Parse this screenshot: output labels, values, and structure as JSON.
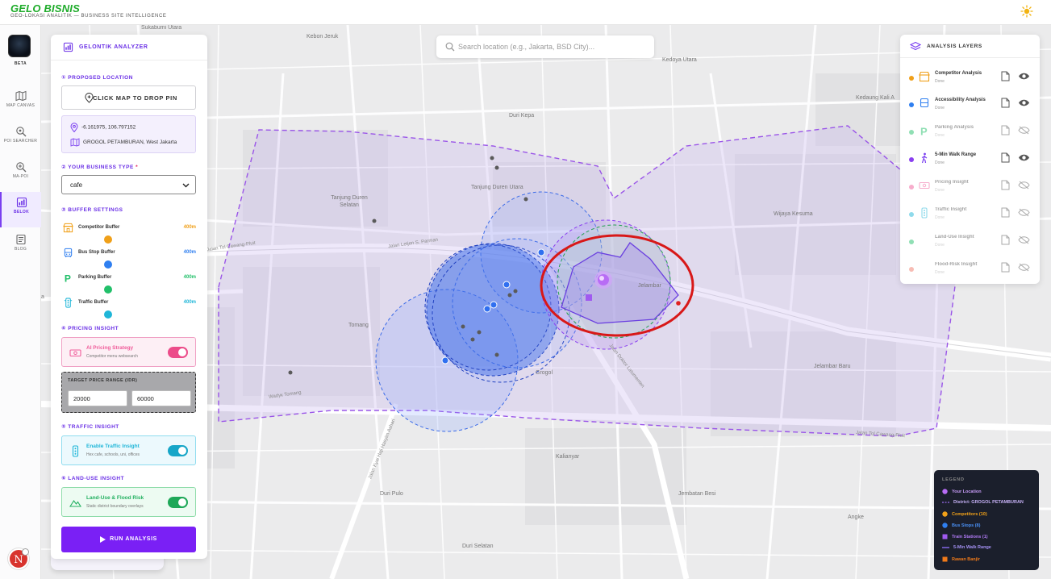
{
  "app": {
    "brand": "GELO BISNIS",
    "tagline": "GEO-LOKASI ANALITIK — BUSINESS SITE INTELLIGENCE",
    "beta_label": "BETA",
    "avatar_letter": "N"
  },
  "nav": [
    {
      "label": "MAP CANVAS",
      "icon": "map-icon"
    },
    {
      "label": "POI SEARCHER",
      "icon": "poi-search-icon"
    },
    {
      "label": "MA-POI",
      "icon": "ma-poi-icon"
    },
    {
      "label": "BELOK",
      "icon": "bar-chart-icon",
      "active": true
    },
    {
      "label": "BLOG",
      "icon": "blog-icon"
    }
  ],
  "analyzer": {
    "title": "GELONTIK ANALYZER",
    "s1": "① PROPOSED LOCATION",
    "drop_pin": "CLICK MAP TO DROP PIN",
    "coords": "-6.161975, 106.797152",
    "district": "GROGOL PETAMBURAN, West Jakarta",
    "s2": "② YOUR BUSINESS TYPE",
    "required": "*",
    "business_type": "cafe",
    "s3": "③ BUFFER SETTINGS",
    "buffers": [
      {
        "name": "Competitor Buffer",
        "value": "400m",
        "color": "#f0a019"
      },
      {
        "name": "Bus Stop Buffer",
        "value": "400m",
        "color": "#2f7ff0"
      },
      {
        "name": "Parking Buffer",
        "value": "400m",
        "color": "#22c06a"
      },
      {
        "name": "Traffic Buffer",
        "value": "400m",
        "color": "#1fb6d8"
      }
    ],
    "s4": "④ PRICING INSIGHT",
    "pricing_title": "AI Pricing Strategy",
    "pricing_sub": "Competitor menu websearch",
    "price_range_label": "TARGET PRICE RANGE (IDR)",
    "price_min": "20000",
    "price_max": "60000",
    "s5": "⑤ TRAFFIC INSIGHT",
    "traffic_title": "Enable Traffic Insight",
    "traffic_sub": "Hex cafe, schools, uni, offices",
    "s6": "⑥ LAND-USE INSIGHT",
    "landuse_title": "Land-Use & Flood Risk",
    "landuse_sub": "Static district boundary overlays",
    "run_label": "RUN ANALYSIS"
  },
  "search": {
    "placeholder": "Search location (e.g., Jakarta, BSD City)..."
  },
  "layers": {
    "title": "ANALYSIS LAYERS",
    "items": [
      {
        "name": "Competitor Analysis",
        "status": "Done",
        "dot": "#f0a019",
        "icon": "store-icon",
        "on": true
      },
      {
        "name": "Accessibility Analysis",
        "status": "Done",
        "dot": "#2f7ff0",
        "icon": "bus-icon",
        "on": true
      },
      {
        "name": "Parking Analysis",
        "status": "Done",
        "dot": "#22c06a",
        "icon": "parking-icon",
        "on": false
      },
      {
        "name": "5-Min Walk Range",
        "status": "Done",
        "dot": "#8a3ff0",
        "icon": "walk-icon",
        "on": true
      },
      {
        "name": "Pricing Insight",
        "status": "Done",
        "dot": "#f05c9a",
        "icon": "money-icon",
        "on": false
      },
      {
        "name": "Traffic Insight",
        "status": "Done",
        "dot": "#1fb6d8",
        "icon": "traffic-icon",
        "on": false
      },
      {
        "name": "Land-Use Insight",
        "status": "Done",
        "dot": "#22c06a",
        "icon": "land-icon",
        "on": false
      },
      {
        "name": "Flood-Risk Insight",
        "status": "Done",
        "dot": "#f07a6a",
        "icon": "flood-icon",
        "on": false
      }
    ]
  },
  "legend": {
    "title": "LEGEND",
    "items": [
      {
        "label": "Your Location",
        "color": "#b86cf5",
        "kind": "dot"
      },
      {
        "label": "District: GROGOL PETAMBURAN",
        "color": "#9a6cf0",
        "kind": "dash"
      },
      {
        "label": "Competitors (10)",
        "color": "#f0a019",
        "kind": "dot"
      },
      {
        "label": "Bus Stops (8)",
        "color": "#2f7ff0",
        "kind": "dot"
      },
      {
        "label": "Train Stations (1)",
        "color": "#a05af0",
        "kind": "square"
      },
      {
        "label": "5-Min Walk Range",
        "color": "#8a6cf0",
        "kind": "line"
      },
      {
        "label": "Rawan Banjir",
        "color": "#f07a1a",
        "kind": "square"
      }
    ]
  },
  "map": {
    "places": [
      "Sukabumi Utara",
      "Kebon Jeruk",
      "Kedoya Utara",
      "Duri Kepa",
      "Kedaung Kali A",
      "Tanjung Duren Utara",
      "Tanjung Duren Selatan",
      "Wijaya Kesuma",
      "Jelambar",
      "Tomang",
      "Grogol",
      "Jelambar Baru",
      "Kalianyar",
      "Duri Pulo",
      "Jembatan Besi",
      "Angke",
      "Duri Selatan",
      "Wadук Tomang",
      "a"
    ],
    "roads": [
      "Jalan Tol Cawang-Pluit",
      "Jalan Letjen S. Parman",
      "Jalan Kyai Haji Hasyim Ashari",
      "Jalan Doktor Latumenten",
      "Jalan Tol Cawang-Pluit"
    ]
  }
}
